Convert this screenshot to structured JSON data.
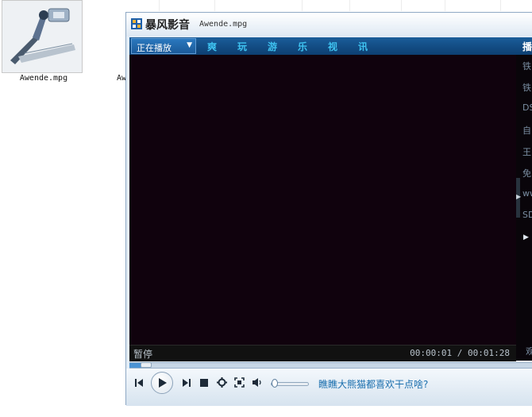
{
  "desktop": {
    "files": [
      {
        "name": "Awende.mpg"
      },
      {
        "name": "Awende"
      }
    ]
  },
  "player": {
    "app_title": "暴风影音",
    "file_title": "Awende.mpg",
    "nav": {
      "active": "正在播放",
      "tabs": [
        "爽",
        "玩",
        "游",
        "乐",
        "视",
        "讯"
      ],
      "right_label": "播"
    },
    "sidebar": {
      "items": [
        "铁",
        "铁",
        "DS",
        "自",
        "王",
        "免",
        "ww",
        "SD"
      ],
      "bottom_partial": "观"
    },
    "status": {
      "state": "暂停",
      "time": "00:00:01 / 00:01:28"
    },
    "playback": {
      "elapsed_seconds": 1,
      "total_seconds": 88,
      "volume_fraction": 0.05
    },
    "controls": {
      "icons": [
        "prev-icon",
        "play-icon",
        "next-icon",
        "stop-icon",
        "settings-icon",
        "fullscreen-icon",
        "volume-icon"
      ]
    },
    "promo_text": "瞧瞧大熊猫都喜欢干点啥?"
  },
  "colors": {
    "nav_bg": "#0d3f71",
    "nav_tab": "#3ec2f0",
    "video_bg": "#10020d",
    "promo": "#1b6fae",
    "progress": "#4b93d3"
  }
}
